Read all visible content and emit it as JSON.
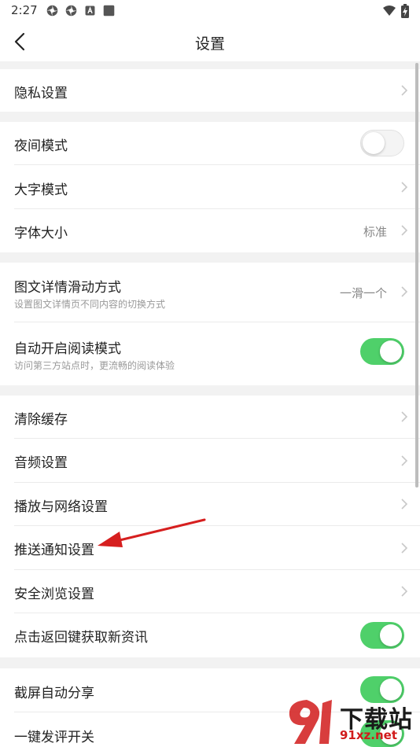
{
  "status_bar": {
    "time": "2:27",
    "left_icons": [
      "settings-app-icon",
      "settings-app-icon",
      "keyboard-a-icon",
      "square-app-icon"
    ],
    "right_icons": [
      "wifi-icon",
      "battery-charging-icon"
    ]
  },
  "header": {
    "title": "设置",
    "back_icon": "chevron-left-icon"
  },
  "groups": [
    {
      "items": [
        {
          "label": "隐私设置",
          "control": "chevron"
        }
      ]
    },
    {
      "items": [
        {
          "label": "夜间模式",
          "control": "toggle",
          "on": false
        },
        {
          "label": "大字模式",
          "control": "chevron"
        },
        {
          "label": "字体大小",
          "control": "chevron",
          "value": "标准"
        }
      ]
    },
    {
      "items": [
        {
          "label": "图文详情滑动方式",
          "sub": "设置图文详情页不同内容的切换方式",
          "control": "chevron",
          "value": "一滑一个"
        },
        {
          "label": "自动开启阅读模式",
          "sub": "访问第三方站点时，更流畅的阅读体验",
          "control": "toggle",
          "on": true
        }
      ]
    },
    {
      "items": [
        {
          "label": "清除缓存",
          "control": "chevron"
        },
        {
          "label": "音频设置",
          "control": "chevron"
        },
        {
          "label": "播放与网络设置",
          "control": "chevron"
        },
        {
          "label": "推送通知设置",
          "control": "chevron"
        },
        {
          "label": "安全浏览设置",
          "control": "chevron"
        },
        {
          "label": "点击返回键获取新资讯",
          "control": "toggle",
          "on": true
        }
      ]
    },
    {
      "items": [
        {
          "label": "截屏自动分享",
          "control": "toggle",
          "on": true
        },
        {
          "label": "一键发评开关",
          "control": "toggle",
          "on": true
        }
      ]
    }
  ],
  "annotation": {
    "type": "red-arrow",
    "points_to": "推送通知设置"
  },
  "watermark": {
    "text": "下载站",
    "url": "91xz.net"
  },
  "colors": {
    "toggle_on": "#4fd06a",
    "arrow": "#d61f1f",
    "background": "#f2f2f2"
  }
}
